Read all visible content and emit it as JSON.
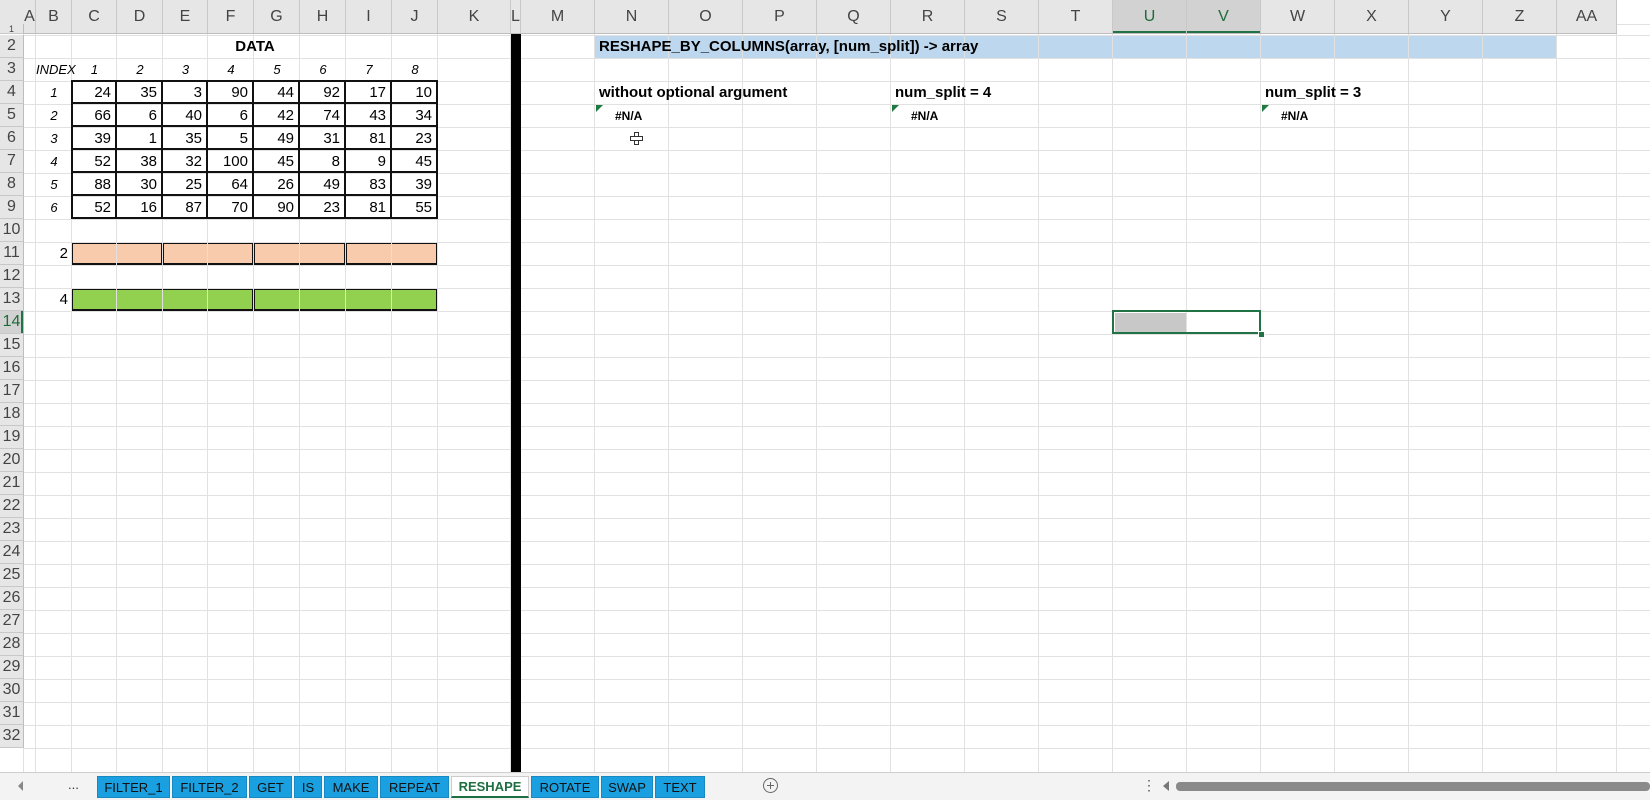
{
  "columns": [
    "A",
    "B",
    "C",
    "D",
    "E",
    "F",
    "G",
    "H",
    "I",
    "J",
    "K",
    "L",
    "M",
    "N",
    "O",
    "P",
    "Q",
    "R",
    "S",
    "T",
    "U",
    "V",
    "W",
    "X",
    "Y",
    "Z",
    "AA"
  ],
  "rows": [
    "1",
    "2",
    "3",
    "4",
    "5",
    "6",
    "7",
    "8",
    "9",
    "10",
    "11",
    "12",
    "13",
    "14",
    "15",
    "16",
    "17",
    "18",
    "19",
    "20",
    "21",
    "22",
    "23",
    "24",
    "25",
    "26",
    "27",
    "28",
    "29",
    "30",
    "31",
    "32"
  ],
  "data_section": {
    "title": "DATA",
    "index_label": "INDEX",
    "col_indices": [
      "1",
      "2",
      "3",
      "4",
      "5",
      "6",
      "7",
      "8"
    ],
    "row_indices": [
      "1",
      "2",
      "3",
      "4",
      "5",
      "6"
    ],
    "values": [
      [
        24,
        35,
        3,
        90,
        44,
        92,
        17,
        10
      ],
      [
        66,
        6,
        40,
        6,
        42,
        74,
        43,
        34
      ],
      [
        39,
        1,
        35,
        5,
        49,
        31,
        81,
        23
      ],
      [
        52,
        38,
        32,
        100,
        45,
        8,
        9,
        45
      ],
      [
        88,
        30,
        25,
        64,
        26,
        49,
        83,
        39
      ],
      [
        52,
        16,
        87,
        70,
        90,
        23,
        81,
        55
      ]
    ],
    "split2_label": "2",
    "split4_label": "4"
  },
  "function_header": "RESHAPE_BY_COLUMNS(array, [num_split]) -> array",
  "examples": [
    {
      "label": "without optional argument",
      "result": "#N/A"
    },
    {
      "label": "num_split = 4",
      "result": "#N/A"
    },
    {
      "label": "num_split = 3",
      "result": "#N/A"
    }
  ],
  "tabs": {
    "ellipsis": "...",
    "items": [
      "FILTER_1",
      "FILTER_2",
      "GET",
      "IS",
      "MAKE",
      "REPEAT",
      "RESHAPE",
      "ROTATE",
      "SWAP",
      "TEXT"
    ],
    "active": "RESHAPE",
    "add_icon": "plus-circle-icon",
    "prev_icon": "triangle-left-icon"
  },
  "colors": {
    "header_band": "#bdd7ee",
    "peach_band": "#f8cbad",
    "green_band": "#92d050",
    "tab_bg": "#1aa0e0",
    "separator": "#000000"
  }
}
